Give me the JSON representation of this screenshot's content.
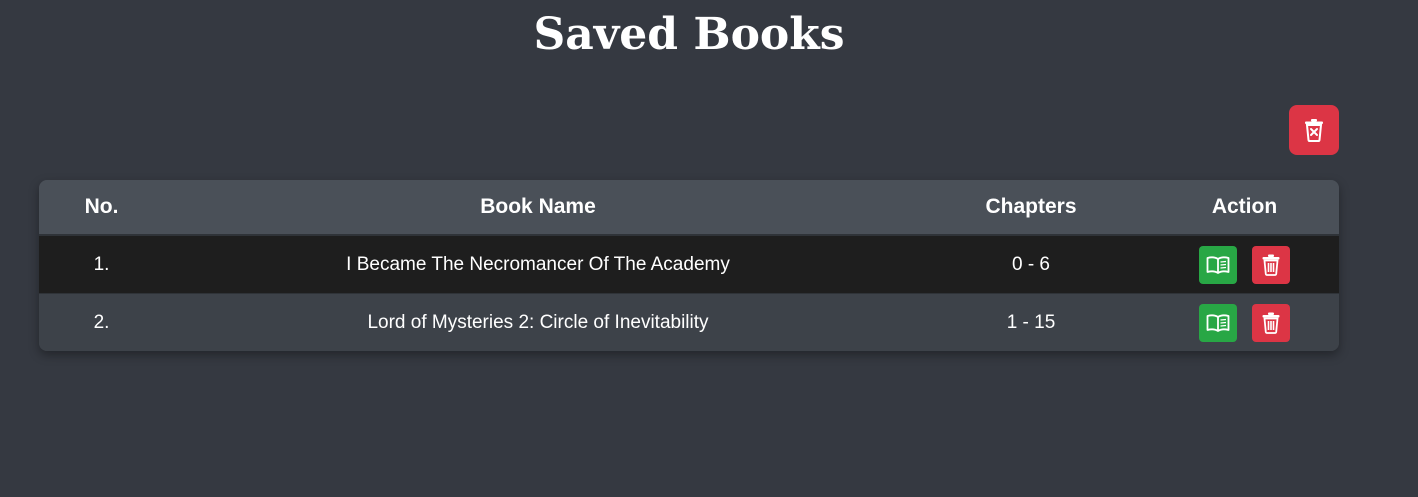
{
  "page": {
    "title": "Saved Books"
  },
  "toolbar": {
    "clear_all_icon": "trash-x-icon"
  },
  "table": {
    "columns": [
      "No.",
      "Book Name",
      "Chapters",
      "Action"
    ],
    "rows": [
      {
        "no": "1.",
        "name": "I Became The Necromancer Of The Academy",
        "chapters": "0 - 6"
      },
      {
        "no": "2.",
        "name": "Lord of Mysteries 2: Circle of Inevitability",
        "chapters": "1 - 15"
      }
    ],
    "row_actions": {
      "read_icon": "book-open-icon",
      "delete_icon": "trash-icon"
    }
  },
  "colors": {
    "background": "#353941",
    "danger": "#dc3545",
    "success": "#28a745",
    "header_bg": "#4a5058",
    "row_dark": "#1e1e1e",
    "row_light": "#3d4249"
  }
}
